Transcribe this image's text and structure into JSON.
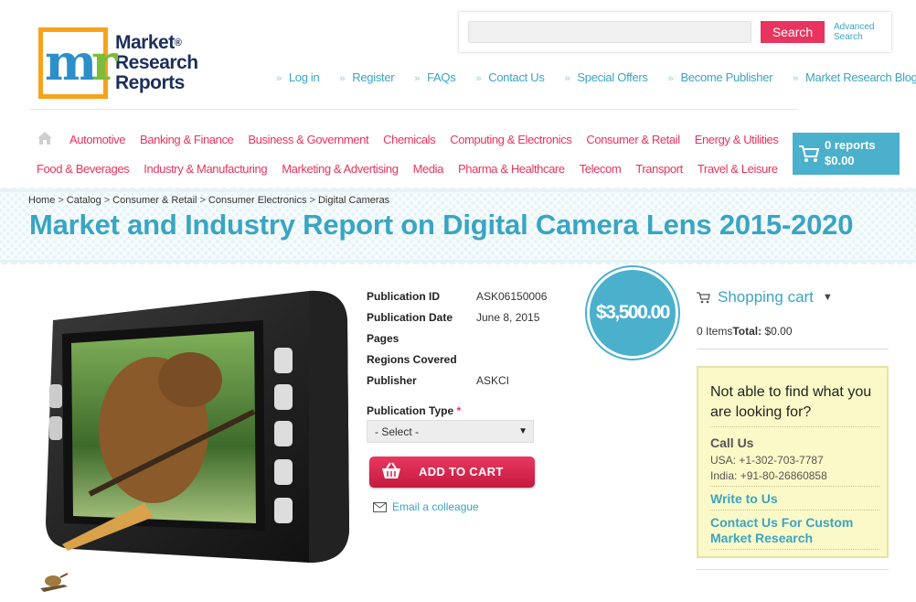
{
  "logo": {
    "line1": "Market",
    "line2": "Research",
    "line3": "Reports",
    "registered": "®",
    "mark_letter_1": "m",
    "mark_letter_2": "r",
    "mark_colors": {
      "frame": "#f7a21b",
      "m": "#2d8fc9",
      "r": "#7dbb3a"
    },
    "text_color": "#1c2f5b"
  },
  "search": {
    "placeholder": "",
    "value": "",
    "button_label": "Search",
    "advanced_label_1": "Advanced",
    "advanced_label_2": "Search"
  },
  "top_links": [
    "Log in",
    "Register",
    "FAQs",
    "Contact Us",
    "Special Offers",
    "Become Publisher",
    "Market Research Blog"
  ],
  "categories_row1": [
    "Automotive",
    "Banking & Finance",
    "Business & Government",
    "Chemicals",
    "Computing & Electronics",
    "Consumer & Retail",
    "Energy & Utilities"
  ],
  "categories_row2": [
    "Food & Beverages",
    "Industry & Manufacturing",
    "Marketing & Advertising",
    "Media",
    "Pharma & Healthcare",
    "Telecom",
    "Transport",
    "Travel & Leisure"
  ],
  "cart_widget": {
    "count": "0 reports",
    "total": "$0.00",
    "icon": "cart-icon"
  },
  "breadcrumb": [
    "Home",
    "Catalog",
    "Consumer & Retail",
    "Consumer Electronics",
    "Digital Cameras"
  ],
  "breadcrumb_sep": ">",
  "title": "Market and Industry Report on Digital Camera Lens 2015-2020",
  "details": [
    {
      "key": "Publication ID",
      "value": "ASK06150006"
    },
    {
      "key": "Publication Date",
      "value": "June 8, 2015"
    },
    {
      "key": "Pages",
      "value": ""
    },
    {
      "key": "Regions Covered",
      "value": ""
    },
    {
      "key": "Publisher",
      "value": "ASKCI"
    }
  ],
  "price": "$3,500.00",
  "publication_type": {
    "label": "Publication Type",
    "required_mark": "*",
    "selected": "- Select -"
  },
  "add_to_cart_label": "ADD TO CART",
  "email_colleague_label": "Email a colleague",
  "shopping_cart": {
    "heading": "Shopping cart",
    "items": "0 Items",
    "total_label": "Total:",
    "total_value": "$0.00"
  },
  "help_box": {
    "title": "Not able to find what you are looking for?",
    "call_us": "Call Us",
    "phone_usa": "USA: +1-302-703-7787",
    "phone_india": "India: +91-80-26860858",
    "write_to_us": "Write to Us",
    "contact_custom": "Contact Us For Custom Market Research"
  },
  "colors": {
    "accent": "#3aa5c2",
    "brand_pink": "#e8345f",
    "help_bg": "#fbf9c7"
  }
}
